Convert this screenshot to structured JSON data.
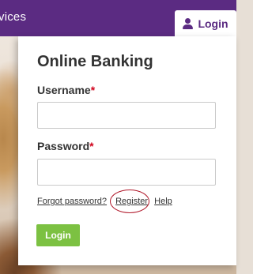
{
  "header": {
    "partial_text": "vices",
    "login_tab_label": "Login",
    "login_tab_icon": "user-icon",
    "background_color": "#5b2b82"
  },
  "card": {
    "title": "Online Banking",
    "username": {
      "label": "Username",
      "required_mark": "*",
      "value": "",
      "placeholder": ""
    },
    "password": {
      "label": "Password",
      "required_mark": "*",
      "value": "",
      "placeholder": ""
    },
    "links": {
      "forgot": "Forgot password?",
      "register": "Register",
      "help": "Help"
    },
    "login_button": "Login"
  },
  "colors": {
    "brand_purple": "#5b2b82",
    "login_green": "#7cc142",
    "required_red": "#d0021b",
    "annotation_circle": "#b0182a"
  }
}
